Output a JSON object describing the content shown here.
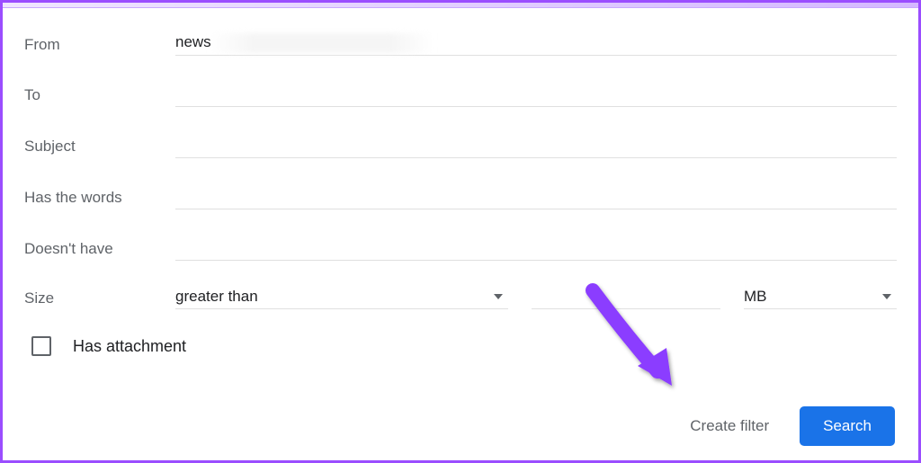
{
  "labels": {
    "from": "From",
    "to": "To",
    "subject": "Subject",
    "hasWords": "Has the words",
    "doesntHave": "Doesn't have",
    "size": "Size",
    "hasAttachment": "Has attachment"
  },
  "values": {
    "from": "news",
    "to": "",
    "subject": "",
    "hasWords": "",
    "doesntHave": "",
    "sizeComparator": "greater than",
    "sizeNumber": "",
    "sizeUnit": "MB",
    "hasAttachmentChecked": false
  },
  "buttons": {
    "createFilter": "Create filter",
    "search": "Search"
  }
}
